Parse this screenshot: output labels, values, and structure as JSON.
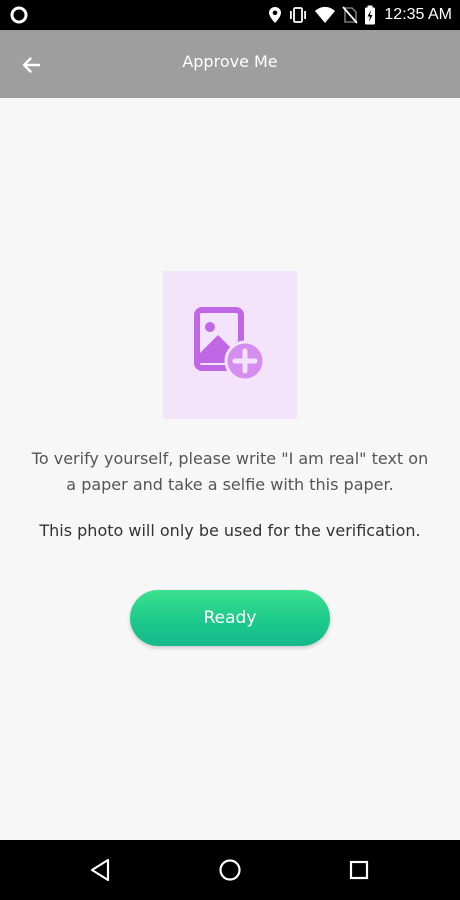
{
  "status_bar": {
    "time": "12:35 AM",
    "icons": [
      "circle-notification-icon",
      "location-icon",
      "vibrate-icon",
      "wifi-icon",
      "no-sim-icon",
      "battery-charging-icon"
    ]
  },
  "app_bar": {
    "title": "Approve Me",
    "back_icon": "arrow-left-icon"
  },
  "main": {
    "photo_placeholder_icon": "add-photo-icon",
    "instruction": "To verify yourself, please write \"I am real\" text on a paper and take a selfie with this paper.",
    "note": "This photo will only be used for the verification.",
    "ready_label": "Ready"
  },
  "nav_bar": {
    "icons": [
      "back-triangle-icon",
      "home-circle-icon",
      "recents-square-icon"
    ]
  },
  "colors": {
    "app_bar": "#9e9e9e",
    "background": "#f7f7f7",
    "photo_box": "#f3e3fb",
    "photo_icon": "#c067e6",
    "button_green": "#1cc98b"
  }
}
